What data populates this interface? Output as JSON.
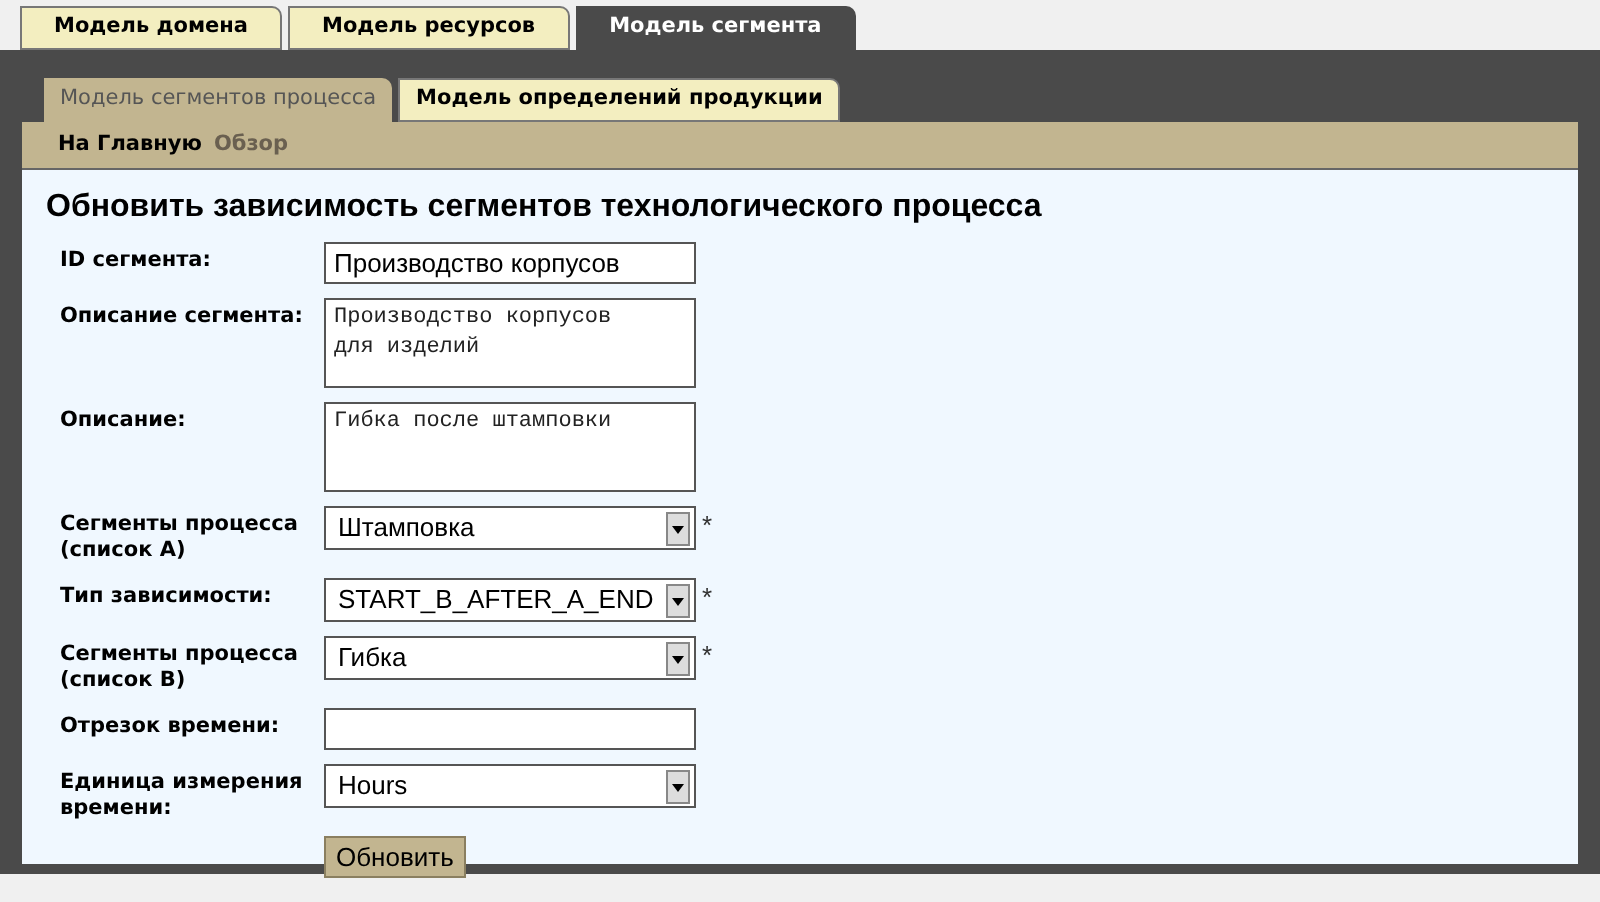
{
  "top_tabs": [
    {
      "label": "Модель домена",
      "selected": false
    },
    {
      "label": "Модель ресурсов",
      "selected": false
    },
    {
      "label": "Модель сегмента",
      "selected": true
    }
  ],
  "sub_tabs": [
    {
      "label": "Модель сегментов процесса",
      "selected": true
    },
    {
      "label": "Модель определений продукции",
      "selected": false
    }
  ],
  "nav_links": [
    {
      "label": "На Главную",
      "selected": true
    },
    {
      "label": "Обзор",
      "selected": false
    }
  ],
  "form": {
    "title": "Обновить зависимость сегментов технологического процесса",
    "fields": [
      {
        "kind": "text",
        "label": "ID сегмента:",
        "value": "Производство корпусов"
      },
      {
        "kind": "textarea",
        "label": "Описание сегмента:",
        "value": "Производство корпусов\nдля изделий"
      },
      {
        "kind": "textarea",
        "label": "Описание:",
        "value": "Гибка после штамповки"
      },
      {
        "kind": "select",
        "label": "Сегменты процесса (список А)",
        "value": "Штамповка",
        "required_mark": "*"
      },
      {
        "kind": "select",
        "label": "Тип зависимости:",
        "value": "START_B_AFTER_A_END",
        "required_mark": "*"
      },
      {
        "kind": "select",
        "label": "Сегменты процесса (список В)",
        "value": "Гибка",
        "required_mark": "*"
      },
      {
        "kind": "text",
        "label": "Отрезок времени:"
      },
      {
        "kind": "select",
        "label": "Единица измерения времени:",
        "value": "Hours"
      }
    ],
    "submit": "Обновить"
  }
}
